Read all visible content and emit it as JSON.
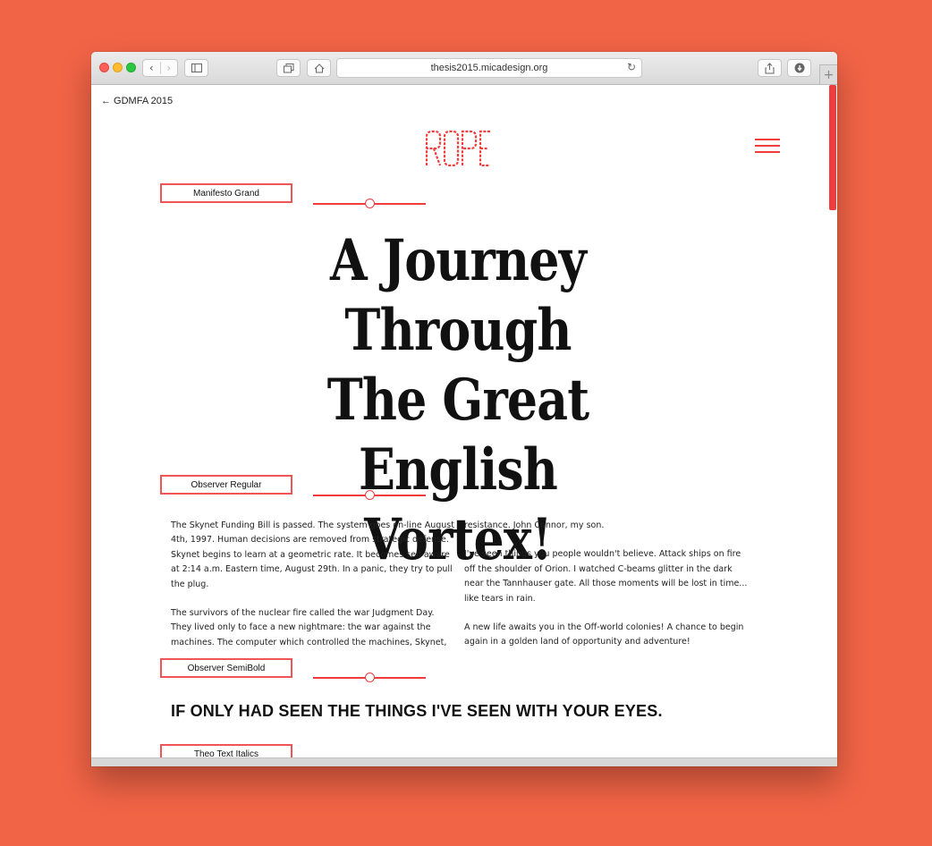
{
  "browser": {
    "url": "thesis2015.micadesign.org",
    "back_glyph": "‹",
    "forward_glyph": "›",
    "new_tab_glyph": "+"
  },
  "page": {
    "back_link": "← GDMFA 2015",
    "logo_text": "ROPE",
    "accent_color": "#ef3d3d",
    "background_color": "#f26446",
    "font_labels": [
      "Manifesto Grand",
      "Observer Regular",
      "Observer SemiBold",
      "Theo Text Italics"
    ],
    "slider_levels": [
      0.5,
      0.5,
      0.5
    ],
    "headline": [
      "A Journey Through",
      "The Great English",
      "Vortex!"
    ],
    "body_left": [
      "The Skynet Funding Bill is passed. The system goes on-line August 4th, 1997. Human decisions are removed from strategic defense. Skynet begins to learn at a geometric rate. It becomes self-aware at 2:14 a.m. Eastern time, August 29th. In a panic, they try to pull the plug.",
      "The survivors of the nuclear fire called the war Judgment Day. They lived only to face a new nightmare: the war against the machines. The computer which controlled the machines, Skynet, sent two Terminators back through time. Their mission: to destroy the leader of the human"
    ],
    "body_right": [
      "resistance. John Connor, my son.",
      "I've seen things you people wouldn't believe. Attack ships on fire off the shoulder of Orion. I watched C-beams glitter in the dark near the Tannhauser gate. All those moments will be lost in time... like tears in rain.",
      "A new life awaits you in the Off-world colonies! A chance to begin again in a golden land of opportunity and adventure!"
    ],
    "caps_line": "IF ONLY HAD SEEN THE THINGS I'VE SEEN WITH YOUR EYES."
  }
}
